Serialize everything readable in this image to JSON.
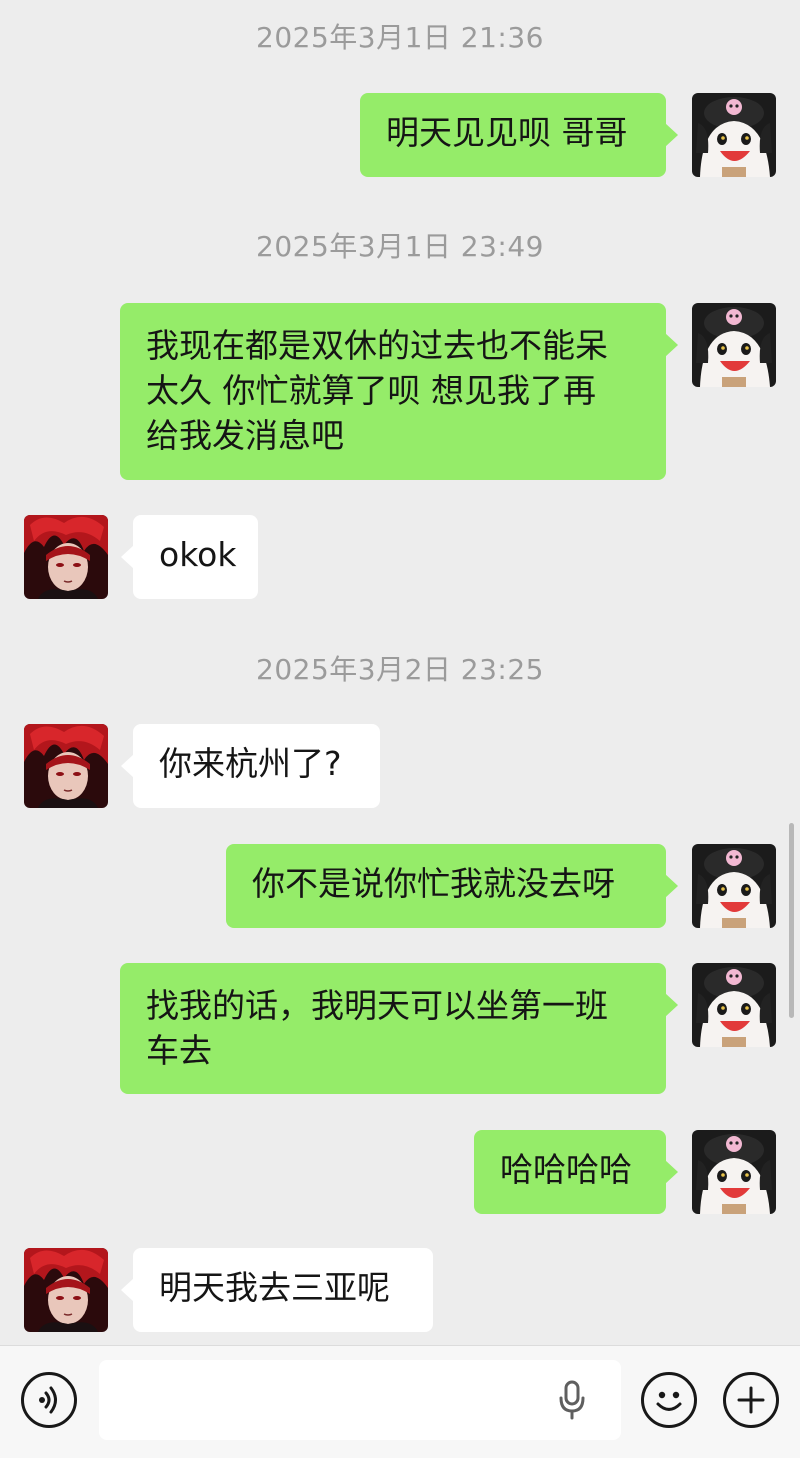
{
  "chat": {
    "timestamps": {
      "t1": "2025年3月1日 21:36",
      "t2": "2025年3月1日 23:49",
      "t3": "2025年3月2日 23:25"
    },
    "messages": [
      {
        "sender": "me",
        "text": "明天见见呗 哥哥"
      },
      {
        "sender": "me",
        "lines": [
          "我现在都是双休的过去也不能呆",
          "太久 你忙就算了呗 想见我了再",
          "给我发消息吧"
        ]
      },
      {
        "sender": "other",
        "text": "okok"
      },
      {
        "sender": "other",
        "text": "你来杭州了?"
      },
      {
        "sender": "me",
        "text": "你不是说你忙我就没去呀"
      },
      {
        "sender": "me",
        "lines": [
          "找我的话，我明天可以坐第一班",
          "车去"
        ]
      },
      {
        "sender": "me",
        "text": "哈哈哈哈"
      },
      {
        "sender": "other",
        "text": "明天我去三亚呢"
      }
    ]
  },
  "input_bar": {
    "voice_icon": "voice-icon",
    "mic_icon": "microphone-icon",
    "emoji_icon": "emoji-icon",
    "more_icon": "plus-icon"
  },
  "colors": {
    "background": "#ededed",
    "my_bubble": "#95ec69",
    "their_bubble": "#ffffff",
    "timestamp": "#9b9b9b"
  }
}
